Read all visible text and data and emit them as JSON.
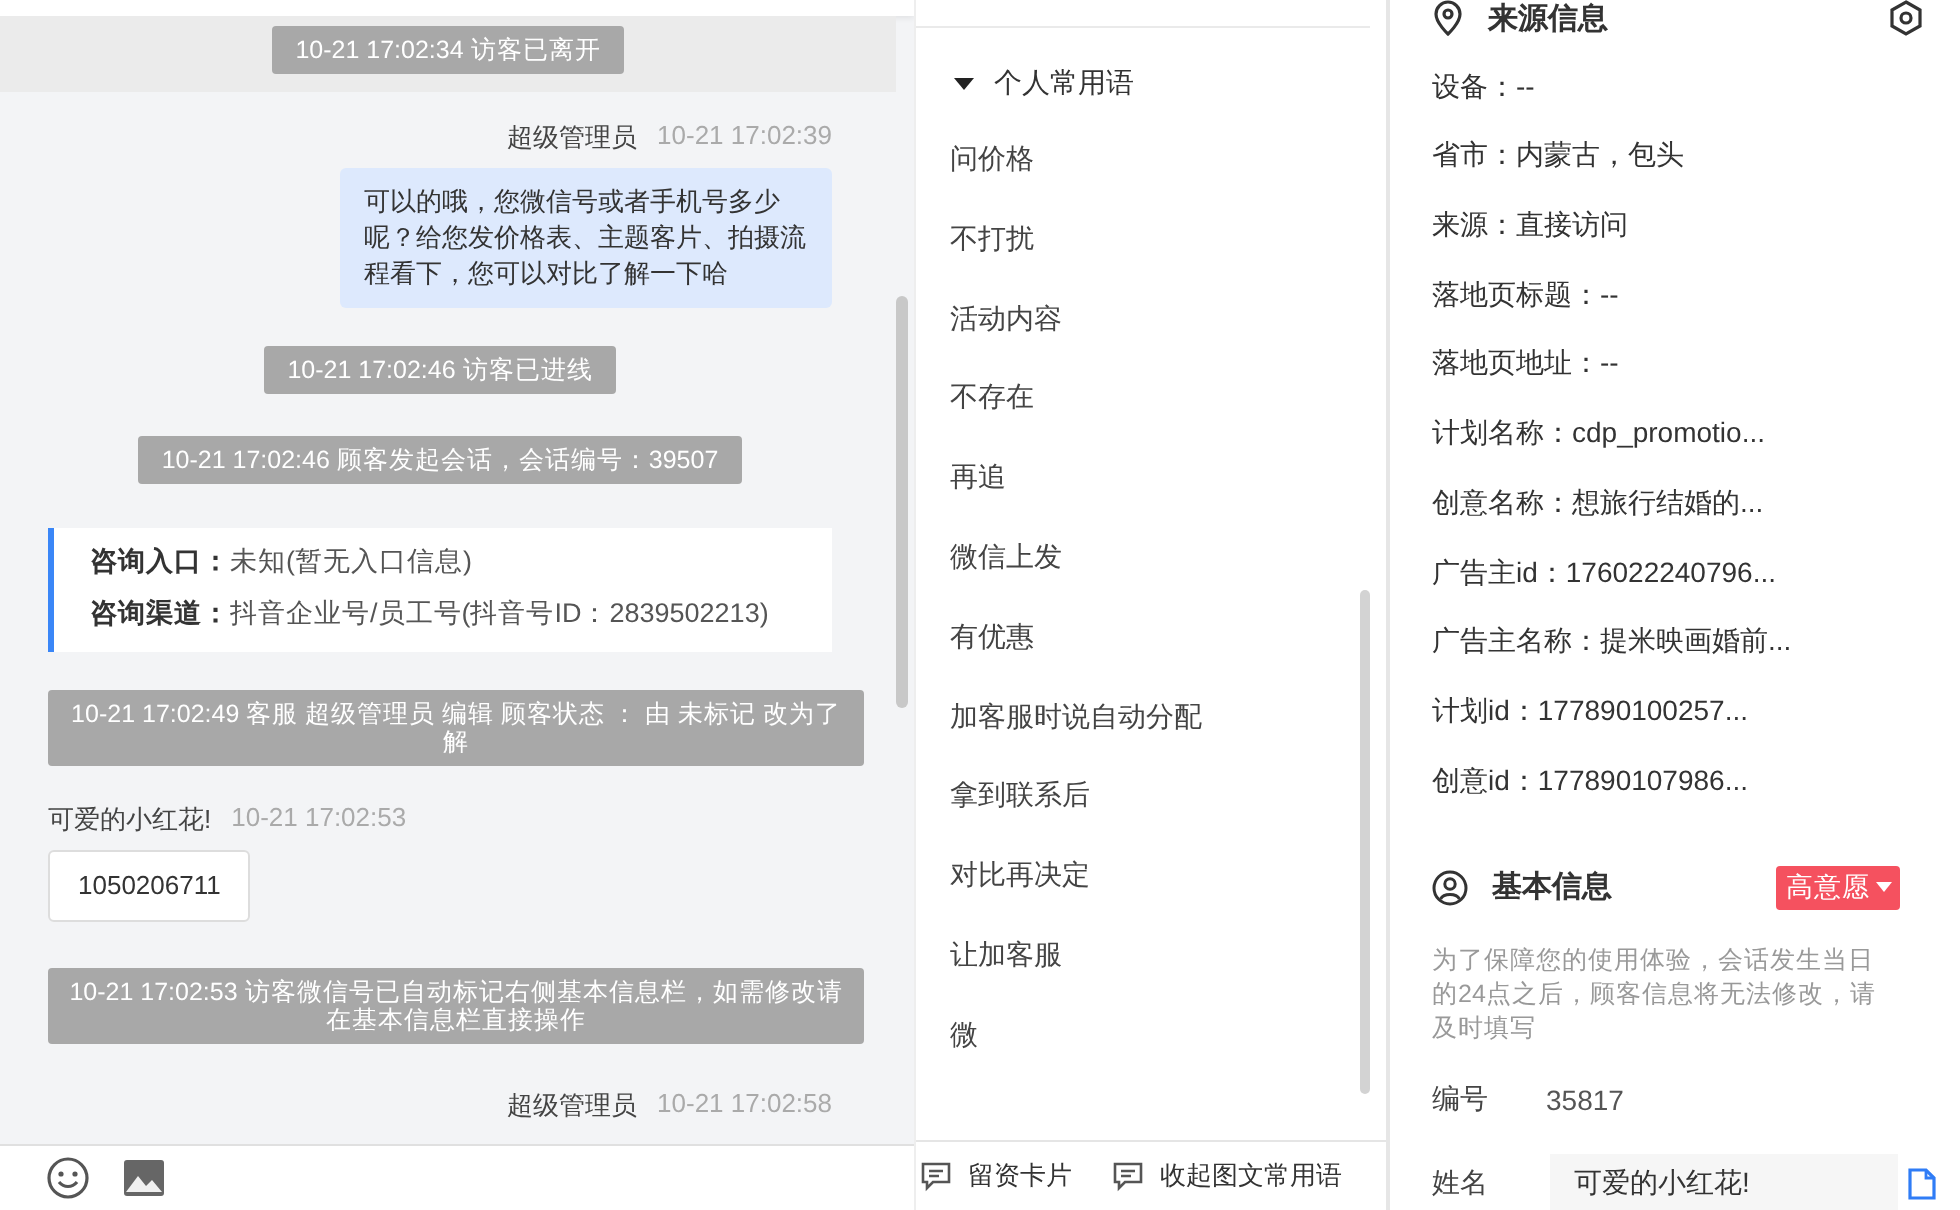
{
  "chat": {
    "messages": [
      {
        "kind": "system",
        "text": "10-21 17:02:34 访客已离开",
        "highlight": true
      },
      {
        "kind": "agent",
        "name": "超级管理员",
        "time": "10-21 17:02:39",
        "text": "可以的哦，您微信号或者手机号多少呢？给您发价格表、主题客片、拍摄流程看下，您可以对比了解一下哈"
      },
      {
        "kind": "system",
        "text": "10-21 17:02:46 访客已进线",
        "highlight": false
      },
      {
        "kind": "system",
        "text": "10-21 17:02:46 顾客发起会话，会话编号：39507",
        "highlight": false
      },
      {
        "kind": "info_card",
        "rows": [
          {
            "label": "咨询入口：",
            "value": "未知(暂无入口信息)"
          },
          {
            "label": "咨询渠道：",
            "value": "抖音企业号/员工号(抖音号ID：2839502213)"
          }
        ]
      },
      {
        "kind": "system_wide",
        "text": "10-21 17:02:49 客服 超级管理员 编辑 顾客状态 ： 由 未标记 改为了解",
        "highlight": false
      },
      {
        "kind": "visitor",
        "name": "可爱的小红花!",
        "time": "10-21 17:02:53",
        "text": "1050206711"
      },
      {
        "kind": "system_wide",
        "text": "10-21 17:02:53 访客微信号已自动标记右侧基本信息栏，如需修改请在基本信息栏直接操作",
        "highlight": false
      },
      {
        "kind": "agent_header",
        "name": "超级管理员",
        "time": "10-21 17:02:58"
      }
    ]
  },
  "phrases": {
    "group": "个人常用语",
    "expanded": true,
    "items": [
      "问价格",
      "不打扰",
      "活动内容",
      "不存在",
      "再追",
      "微信上发",
      "有优惠",
      "加客服时说自动分配",
      "拿到联系后",
      "对比再决定",
      "让加客服",
      "微"
    ],
    "actions": [
      "留资卡片",
      "收起图文常用语"
    ]
  },
  "source_info": {
    "title": "来源信息",
    "rows": [
      "设备：--",
      "省市：内蒙古，包头",
      "来源：直接访问",
      "落地页标题：--",
      "落地页地址：--",
      "计划名称：cdp_promotio...",
      "创意名称：想旅行结婚的...",
      "广告主id：176022240796...",
      "广告主名称：提米映画婚前...",
      "计划id：177890100257...",
      "创意id：177890107986..."
    ]
  },
  "basic_info": {
    "title": "基本信息",
    "tag": "高意愿",
    "note": "为了保障您的使用体验，会话发生当日的24点之后，顾客信息将无法修改，请及时填写",
    "fields": [
      {
        "kind": "text",
        "label": "编号",
        "value": "35817"
      },
      {
        "kind": "input",
        "label": "姓名",
        "value": "可爱的小红花!"
      }
    ]
  }
}
